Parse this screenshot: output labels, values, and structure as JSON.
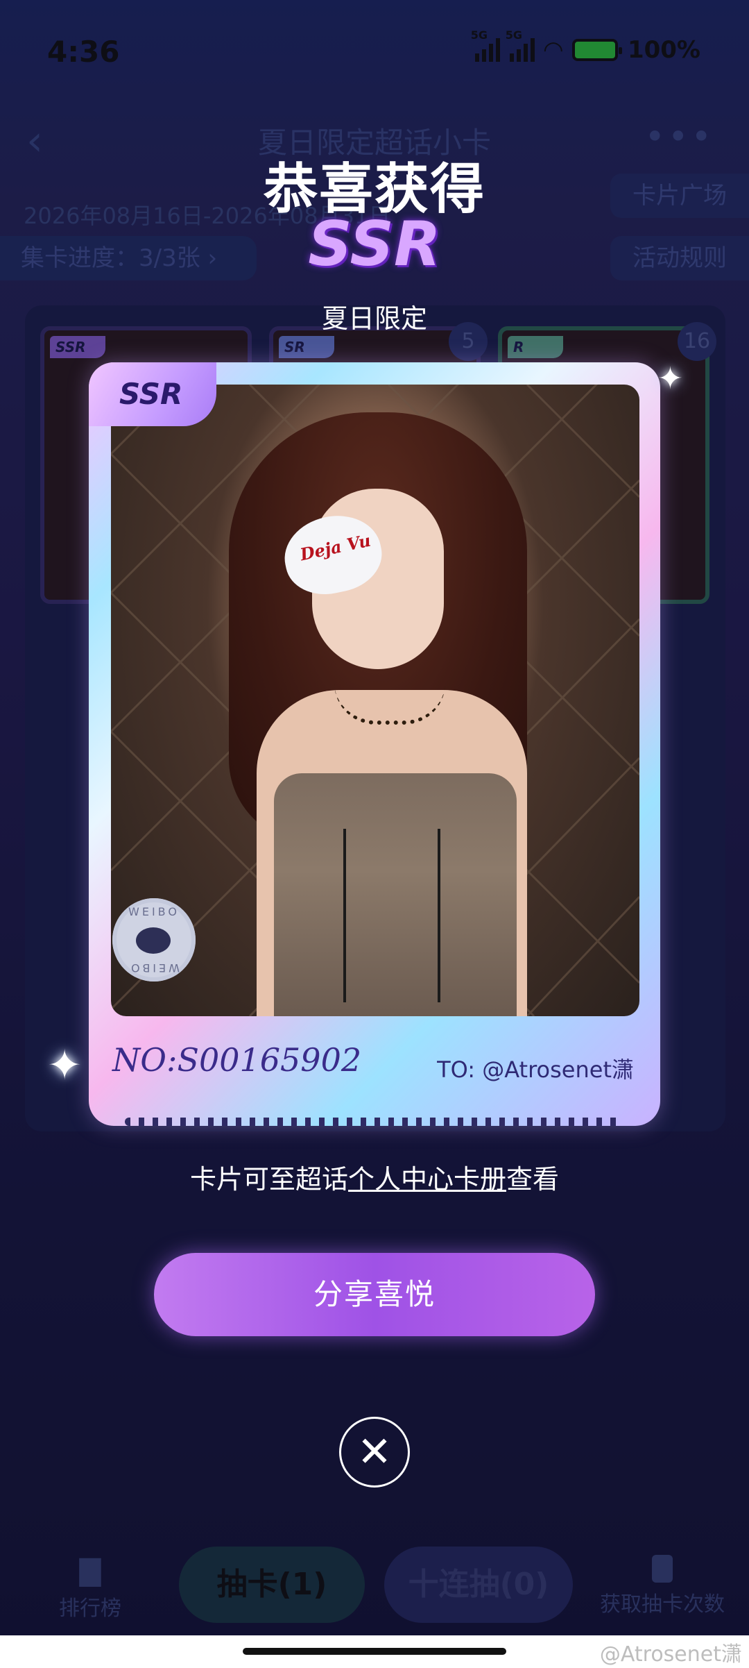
{
  "status_bar": {
    "time": "4:36",
    "signal1": "5G",
    "signal2": "5G",
    "battery": "100%"
  },
  "header": {
    "title": "夏日限定超话小卡",
    "date_range": "2026年08月16日-2026年08月31日",
    "progress": "集卡进度：3/3张",
    "card_plaza": "卡片广场",
    "rules": "活动规则"
  },
  "mini_cards": [
    {
      "rarity": "SSR",
      "count": ""
    },
    {
      "rarity": "SR",
      "count": "5"
    },
    {
      "rarity": "R",
      "count": "16"
    }
  ],
  "modal": {
    "congrats": "恭喜获得",
    "rarity": "SSR",
    "series": "夏日限定",
    "card_tag": "SSR",
    "patch_text": "Deja Vu",
    "weibo_seal_top": "WEIBO",
    "weibo_seal_bottom": "WEIBO",
    "card_no": "NO:S00165902",
    "card_to": "TO: @Atrosenet潇",
    "note_prefix": "卡片可至超话",
    "note_link": "个人中心卡册",
    "note_suffix": "查看",
    "share_button": "分享喜悦",
    "close_symbol": "✕"
  },
  "bottom_bar": {
    "rank_label": "排行榜",
    "draw_button": "抽卡(1)",
    "ten_draw_button": "十连抽(0)",
    "get_draws_label": "获取抽卡次数"
  },
  "watermark": "@Atrosenet潇",
  "colors": {
    "background": "#151538",
    "rarity_purple": "#d9a7ff",
    "share_button": "#b863e8"
  }
}
